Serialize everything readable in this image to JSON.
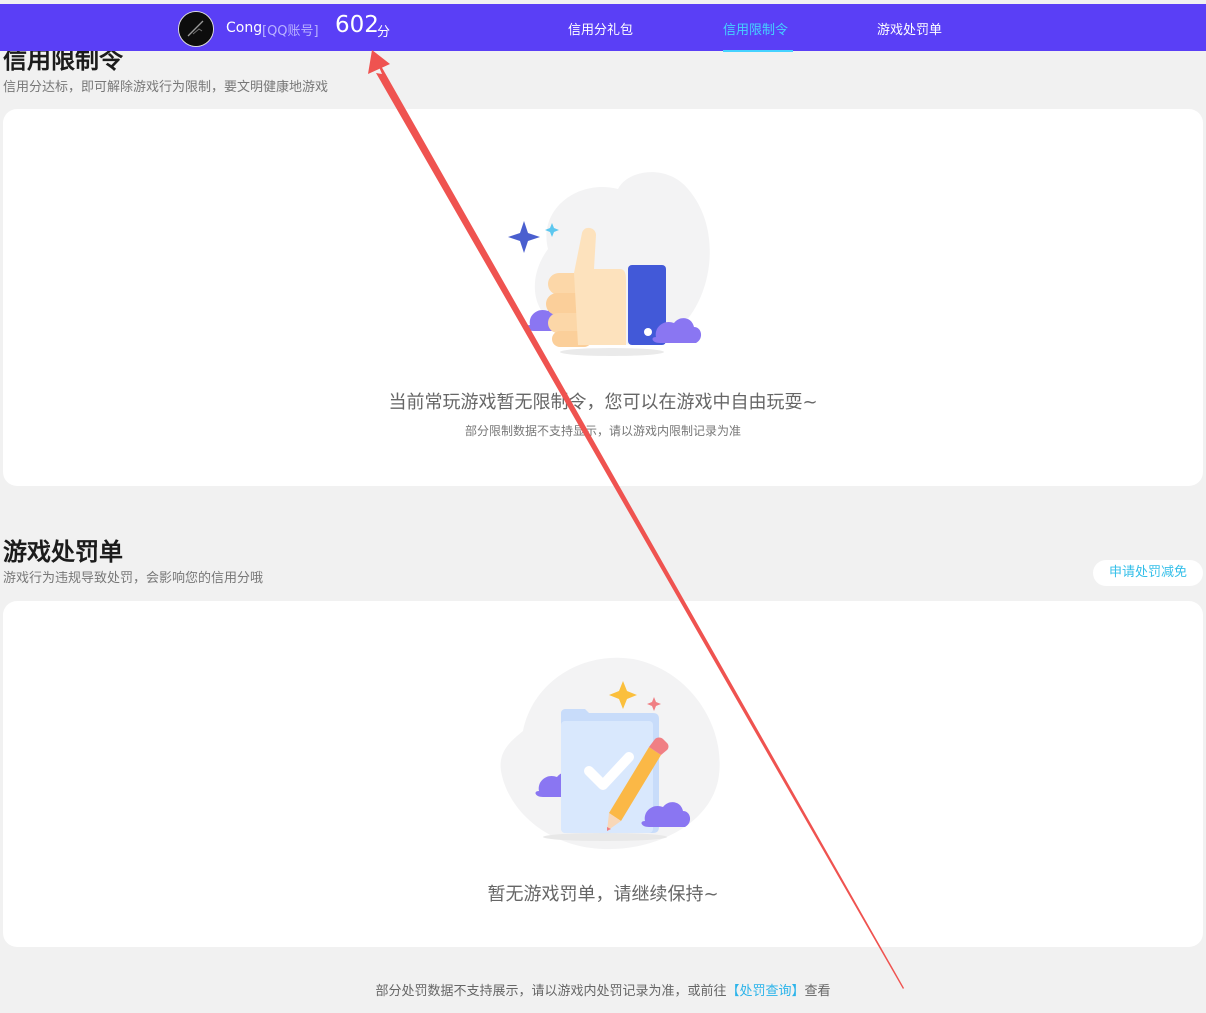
{
  "header": {
    "user_name": "Cong",
    "account_type": "[QQ账号]",
    "score": "602",
    "score_unit": "分",
    "tabs": [
      {
        "label": "信用分礼包",
        "active": false
      },
      {
        "label": "信用限制令",
        "active": true
      },
      {
        "label": "游戏处罚单",
        "active": false
      }
    ]
  },
  "restriction": {
    "title": "信用限制令",
    "subtitle": "信用分达标，即可解除游戏行为限制，要文明健康地游戏",
    "empty_text": "当前常玩游戏暂无限制令，您可以在游戏中自由玩耍~",
    "note": "部分限制数据不支持显示，请以游戏内限制记录为准"
  },
  "penalty": {
    "title": "游戏处罚单",
    "subtitle": "游戏行为违规导致处罚，会影响您的信用分哦",
    "appeal_button": "申请处罚减免",
    "empty_text": "暂无游戏罚单，请继续保持~"
  },
  "footer": {
    "prefix": "部分处罚数据不支持展示，请以游戏内处罚记录为准，或前往",
    "link": "【处罚查询】",
    "suffix": "查看"
  },
  "colors": {
    "topbar": "#5a3ff6",
    "active_tab": "#45d2ff",
    "link": "#2cb4ea",
    "annotation_arrow": "#ef5350"
  }
}
